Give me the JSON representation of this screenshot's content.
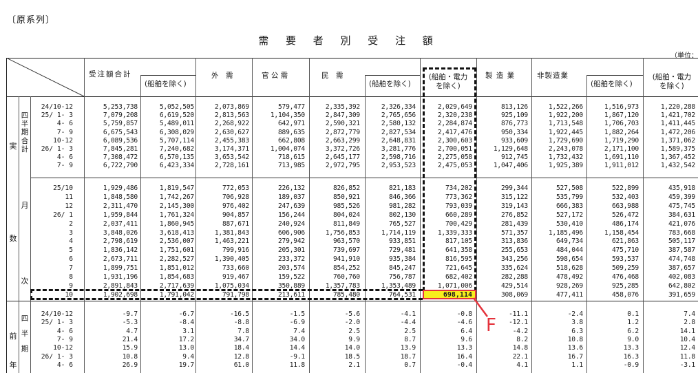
{
  "series_note": "〔原系列〕",
  "title": "需 要 者 別 受 注 額",
  "unit_label": "（単位：",
  "headers": {
    "col1": "受注額合計",
    "col1_sub": "(船舶を除く)",
    "col3": "外　需",
    "col4": "官 公 需",
    "col5": "民　需",
    "col5_sub": "(船舶を除く)",
    "col7_l1": "(船舶・電力",
    "col7_l2": "を除く)",
    "col8": "製 造 業",
    "col9": "非製造業",
    "col9_sub": "(船舶を除く)",
    "col11_l1": "(船舶・電力",
    "col11_l2": "を除く)"
  },
  "side_labels": {
    "jissu": [
      "実",
      "数"
    ],
    "quarterly": [
      "四",
      "半",
      "期",
      "合",
      "計"
    ],
    "monthly": [
      "月",
      "次"
    ],
    "zennen": [
      "前",
      "年"
    ],
    "zennen_quarter": [
      "四",
      "半",
      "期"
    ]
  },
  "quarterly_rows": [
    {
      "label": "24/10-12",
      "v": [
        "5,253,738",
        "5,052,505",
        "2,073,869",
        "579,477",
        "2,335,392",
        "2,326,334",
        "2,029,649",
        "813,126",
        "1,522,266",
        "1,516,973",
        "1,220,288"
      ]
    },
    {
      "label": "25/ 1- 3",
      "v": [
        "7,079,208",
        "6,619,520",
        "2,813,563",
        "1,104,350",
        "2,847,309",
        "2,765,656",
        "2,320,238",
        "925,109",
        "1,922,200",
        "1,867,120",
        "1,421,702"
      ]
    },
    {
      "label": "4- 6",
      "v": [
        "5,759,857",
        "5,489,011",
        "2,268,922",
        "642,971",
        "2,590,321",
        "2,580,132",
        "2,284,874",
        "876,773",
        "1,713,548",
        "1,706,703",
        "1,411,445"
      ]
    },
    {
      "label": "7- 9",
      "v": [
        "6,675,543",
        "6,308,029",
        "2,630,627",
        "889,635",
        "2,872,779",
        "2,827,534",
        "2,417,476",
        "950,334",
        "1,922,445",
        "1,882,264",
        "1,472,206"
      ]
    },
    {
      "label": "10-12",
      "v": [
        "6,089,536",
        "5,707,114",
        "2,455,383",
        "662,808",
        "2,663,299",
        "2,648,831",
        "2,300,603",
        "933,609",
        "1,729,690",
        "1,719,290",
        "1,371,062"
      ]
    },
    {
      "label": "26/ 1- 3",
      "v": [
        "7,845,281",
        "7,240,682",
        "3,174,371",
        "1,004,074",
        "3,372,726",
        "3,281,776",
        "2,700,051",
        "1,129,648",
        "2,243,078",
        "2,171,100",
        "1,589,375"
      ]
    },
    {
      "label": "4- 6",
      "v": [
        "7,308,472",
        "6,570,135",
        "3,653,542",
        "718,615",
        "2,645,177",
        "2,598,716",
        "2,275,058",
        "912,745",
        "1,732,432",
        "1,691,110",
        "1,367,452"
      ]
    },
    {
      "label": "7- 9",
      "v": [
        "6,722,790",
        "6,423,334",
        "2,728,161",
        "713,985",
        "2,972,795",
        "2,953,523",
        "2,475,053",
        "1,047,406",
        "1,925,389",
        "1,911,012",
        "1,432,542"
      ]
    }
  ],
  "monthly_rows": [
    {
      "label": "25/10",
      "v": [
        "1,929,486",
        "1,819,547",
        "772,053",
        "226,132",
        "826,852",
        "821,183",
        "734,202",
        "299,344",
        "527,508",
        "522,899",
        "435,918"
      ]
    },
    {
      "label": "11",
      "v": [
        "1,848,580",
        "1,742,267",
        "706,928",
        "189,037",
        "850,921",
        "846,366",
        "773,362",
        "315,122",
        "535,799",
        "532,403",
        "459,399"
      ]
    },
    {
      "label": "12",
      "v": [
        "2,311,470",
        "2,145,300",
        "976,402",
        "247,639",
        "985,526",
        "981,282",
        "793,039",
        "319,143",
        "666,383",
        "663,988",
        "475,745"
      ]
    },
    {
      "label": "26/ 1",
      "v": [
        "1,959,844",
        "1,761,324",
        "904,857",
        "156,244",
        "804,024",
        "802,130",
        "660,289",
        "276,852",
        "527,172",
        "526,472",
        "384,631"
      ]
    },
    {
      "label": "2",
      "v": [
        "2,037,411",
        "1,860,945",
        "887,671",
        "240,924",
        "811,849",
        "765,527",
        "700,429",
        "281,439",
        "530,410",
        "486,174",
        "421,076"
      ]
    },
    {
      "label": "3",
      "v": [
        "3,848,026",
        "3,618,413",
        "1,381,843",
        "606,906",
        "1,756,853",
        "1,714,119",
        "1,339,333",
        "571,357",
        "1,185,496",
        "1,158,454",
        "783,668"
      ]
    },
    {
      "label": "4",
      "v": [
        "2,798,619",
        "2,536,007",
        "1,463,221",
        "279,942",
        "963,570",
        "933,851",
        "817,105",
        "313,836",
        "649,734",
        "621,863",
        "505,117"
      ]
    },
    {
      "label": "5",
      "v": [
        "1,836,142",
        "1,751,601",
        "799,916",
        "205,301",
        "739,697",
        "729,481",
        "641,358",
        "255,653",
        "484,044",
        "475,710",
        "387,587"
      ]
    },
    {
      "label": "6",
      "v": [
        "2,673,711",
        "2,282,527",
        "1,390,405",
        "233,372",
        "941,910",
        "935,384",
        "816,595",
        "343,256",
        "598,654",
        "593,537",
        "474,748"
      ]
    },
    {
      "label": "7",
      "v": [
        "1,899,751",
        "1,851,012",
        "733,660",
        "203,574",
        "854,252",
        "845,247",
        "721,645",
        "335,624",
        "518,628",
        "509,259",
        "387,657"
      ]
    },
    {
      "label": "8",
      "v": [
        "1,931,196",
        "1,854,683",
        "919,467",
        "159,522",
        "760,760",
        "756,787",
        "682,402",
        "282,288",
        "478,492",
        "476,468",
        "402,083"
      ]
    },
    {
      "label": "9",
      "v": [
        "2,891,843",
        "2,717,639",
        "1,075,034",
        "350,889",
        "1,357,783",
        "1,353,489",
        "1,071,006",
        "429,514",
        "928,269",
        "925,285",
        "642,802"
      ]
    },
    {
      "label": "10",
      "v": [
        "1,902,698",
        "1,791,042",
        "791,798",
        "213,611",
        "785,480",
        "764,531",
        "698,114",
        "308,069",
        "477,411",
        "458,076",
        "391,659"
      ]
    }
  ],
  "yoy_rows": [
    {
      "label": "24/10-12",
      "v": [
        "-9.7",
        "-6.7",
        "-16.5",
        "-1.5",
        "-5.6",
        "-4.1",
        "-0.8",
        "-11.1",
        "-2.4",
        "0.1",
        "7.4"
      ]
    },
    {
      "label": "25/ 1- 3",
      "v": [
        "-5.3",
        "-8.4",
        "-8.8",
        "-6.9",
        "-2.0",
        "-4.4",
        "-4.6",
        "-12.1",
        "3.8",
        "1.2",
        "2.8"
      ]
    },
    {
      "label": "4- 6",
      "v": [
        "4.7",
        "3.1",
        "7.8",
        "7.4",
        "2.5",
        "2.5",
        "6.4",
        "-4.2",
        "6.3",
        "6.2",
        "14.1"
      ]
    },
    {
      "label": "7- 9",
      "v": [
        "21.4",
        "17.2",
        "34.7",
        "34.0",
        "9.9",
        "8.7",
        "9.6",
        "8.2",
        "10.8",
        "9.0",
        "10.4"
      ]
    },
    {
      "label": "10-12",
      "v": [
        "15.9",
        "13.0",
        "18.4",
        "14.4",
        "14.0",
        "13.9",
        "13.3",
        "14.8",
        "13.6",
        "13.3",
        "12.4"
      ]
    },
    {
      "label": "26/ 1- 3",
      "v": [
        "10.8",
        "9.4",
        "12.8",
        "-9.1",
        "18.5",
        "18.7",
        "16.4",
        "22.1",
        "16.7",
        "16.3",
        "11.8"
      ]
    },
    {
      "label": "4- 6",
      "v": [
        "26.9",
        "19.7",
        "61.0",
        "11.8",
        "2.1",
        "0.7",
        "-0.4",
        "4.1",
        "1.1",
        "-0.9",
        "-3.1"
      ]
    }
  ],
  "highlight": {
    "value": "698,114",
    "marker_label": "F",
    "marker_color": "#e4323b",
    "fill_color": "#f7ee1d"
  }
}
